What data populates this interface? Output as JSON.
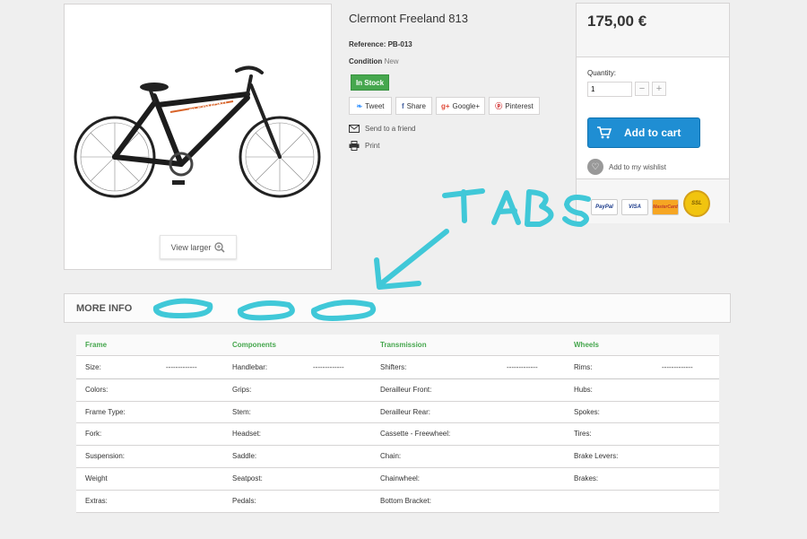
{
  "product": {
    "title": "Clermont Freeland 813",
    "reference_label": "Reference:",
    "reference_value": "PB-013",
    "condition_label": "Condition",
    "condition_value": "New",
    "stock_badge": "In Stock",
    "view_larger": "View larger"
  },
  "share": [
    {
      "icon": "twitter-icon",
      "glyph": "❧",
      "label": "Tweet"
    },
    {
      "icon": "facebook-icon",
      "glyph": "f",
      "label": "Share"
    },
    {
      "icon": "google-plus-icon",
      "glyph": "g+",
      "label": "Google+"
    },
    {
      "icon": "pinterest-icon",
      "glyph": "ⓟ",
      "label": "Pinterest"
    }
  ],
  "links": {
    "send_friend": "Send to a friend",
    "print": "Print"
  },
  "buy": {
    "price": "175,00 €",
    "quantity_label": "Quantity:",
    "quantity_value": "1",
    "minus": "−",
    "plus": "+",
    "add_to_cart": "Add to cart",
    "wishlist": "Add to my wishlist"
  },
  "payments": [
    {
      "name": "paypal-logo",
      "label": "PayPal",
      "color": "#1a3a8a"
    },
    {
      "name": "visa-logo",
      "label": "VISA",
      "color": "#1a3a8a"
    },
    {
      "name": "mastercard-logo",
      "label": "MasterCard",
      "color": "#c0392b"
    },
    {
      "name": "ssl-badge",
      "label": "SSL",
      "color": "#b8860b"
    }
  ],
  "more_info": {
    "heading": "MORE INFO"
  },
  "specs": {
    "columns": [
      "Frame",
      "Components",
      "Transmission",
      "Wheels"
    ],
    "rows": [
      [
        "Size:",
        "-------------",
        "Handlebar:",
        "-------------",
        "Shifters:",
        "-------------",
        "Rims:",
        "-------------"
      ],
      [
        "Colors:",
        "",
        "Grips:",
        "",
        "Derailleur Front:",
        "",
        "Hubs:",
        ""
      ],
      [
        "Frame Type:",
        "",
        "Stem:",
        "",
        "Derailleur Rear:",
        "",
        "Spokes:",
        ""
      ],
      [
        "Fork:",
        "",
        "Headset:",
        "",
        "Cassette - Freewheel:",
        "",
        "Tires:",
        ""
      ],
      [
        "Suspension:",
        "",
        "Saddle:",
        "",
        "Chain:",
        "",
        "Brake Levers:",
        ""
      ],
      [
        "Weight",
        "",
        "Seatpost:",
        "",
        "Chainwheel:",
        "",
        "Brakes:",
        ""
      ],
      [
        "Extras:",
        "",
        "Pedals:",
        "",
        "Bottom Bracket:",
        "",
        "",
        ""
      ]
    ]
  },
  "annotation": {
    "text": "TaBs",
    "color": "#40c8d8"
  }
}
